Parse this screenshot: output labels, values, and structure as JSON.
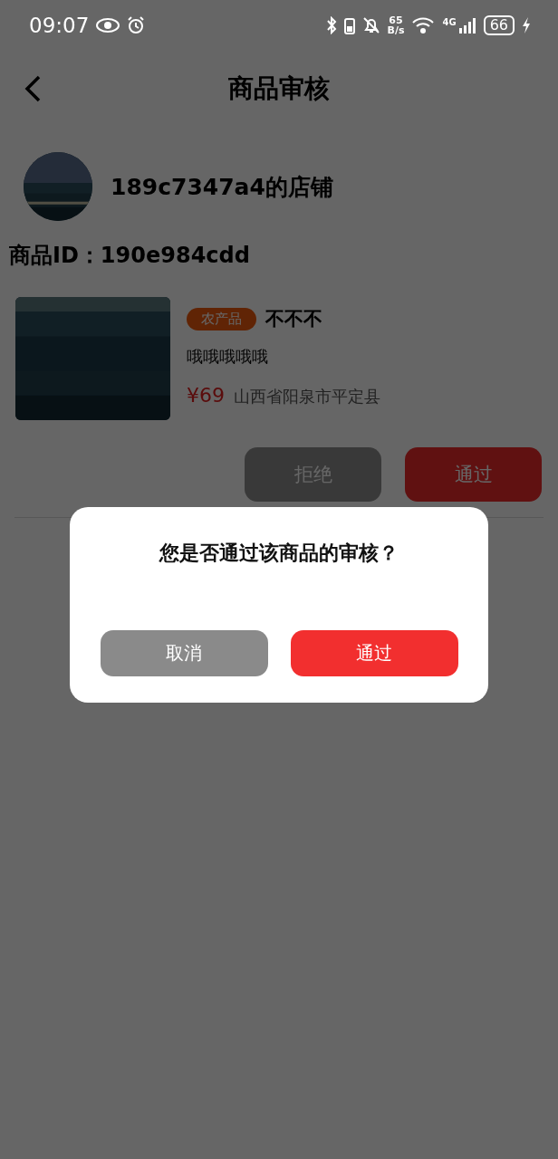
{
  "status_bar": {
    "time": "09:07",
    "net_speed": [
      "65",
      "B/s"
    ],
    "network": "4G",
    "battery": "66"
  },
  "header": {
    "title": "商品审核"
  },
  "shop": {
    "name": "189c7347a4的店铺"
  },
  "product": {
    "id_text": "商品ID：190e984cdd",
    "tag": "农产品",
    "name": "不不不",
    "description": "哦哦哦哦哦",
    "price": "¥69",
    "location": "山西省阳泉市平定县"
  },
  "actions": [
    {
      "label": "拒绝",
      "kind": "reject"
    },
    {
      "label": "通过",
      "kind": "approve"
    }
  ],
  "dialog": {
    "message": "您是否通过该商品的审核？",
    "buttons": [
      {
        "label": "取消",
        "kind": "cancel"
      },
      {
        "label": "通过",
        "kind": "confirm"
      }
    ]
  }
}
